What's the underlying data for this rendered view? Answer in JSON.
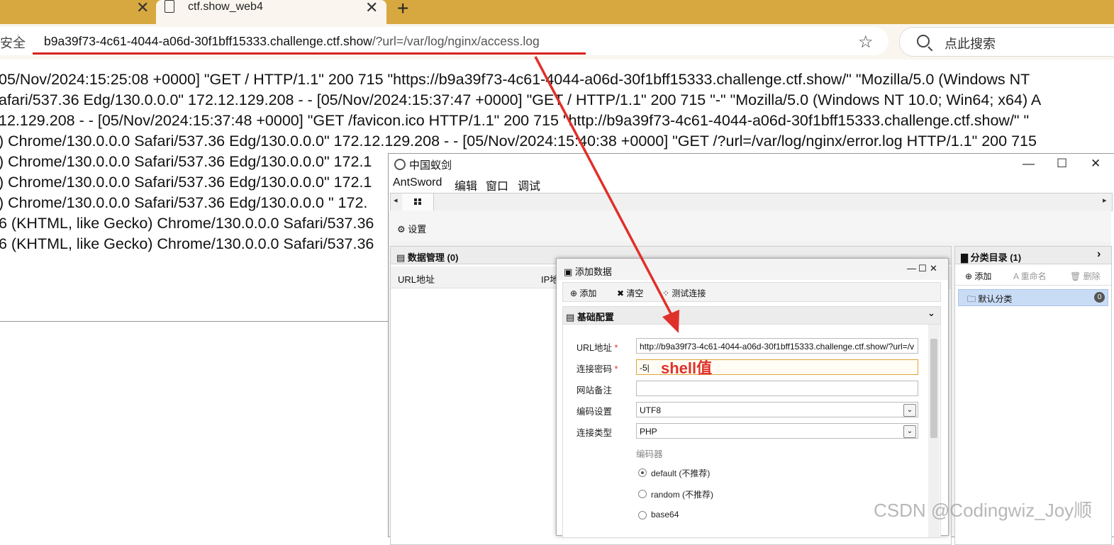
{
  "browser": {
    "tabs": [
      {
        "title": ""
      },
      {
        "title": "ctf.show_web4"
      }
    ],
    "close_glyph": "✕",
    "new_tab_glyph": "+",
    "address": {
      "security": "安全",
      "host": "b9a39f73-4c61-4044-a06d-30f1bff15333.challenge.ctf.show",
      "path": "/?url=/var/log/nginx/access.log"
    },
    "star_glyph": "☆",
    "search_placeholder": "点此搜索"
  },
  "log_lines": [
    "05/Nov/2024:15:25:08 +0000] \"GET / HTTP/1.1\" 200 715 \"https://b9a39f73-4c61-4044-a06d-30f1bff15333.challenge.ctf.show/\" \"Mozilla/5.0 (Windows NT",
    "afari/537.36 Edg/130.0.0.0\" 172.12.129.208 - - [05/Nov/2024:15:37:47 +0000] \"GET / HTTP/1.1\" 200 715 \"-\" \"Mozilla/5.0 (Windows NT 10.0; Win64; x64) A",
    "12.129.208 - - [05/Nov/2024:15:37:48 +0000] \"GET /favicon.ico HTTP/1.1\" 200 715 \"http://b9a39f73-4c61-4044-a06d-30f1bff15333.challenge.ctf.show/\" \"",
    ") Chrome/130.0.0.0 Safari/537.36 Edg/130.0.0.0\" 172.12.129.208 - - [05/Nov/2024:15:40:38 +0000] \"GET /?url=/var/log/nginx/error.log HTTP/1.1\" 200 715",
    ") Chrome/130.0.0.0 Safari/537.36 Edg/130.0.0.0\" 172.1",
    ") Chrome/130.0.0.0 Safari/537.36 Edg/130.0.0.0\" 172.1",
    ") Chrome/130.0.0.0 Safari/537.36 Edg/130.0.0.0 \" 172.",
    "6 (KHTML, like Gecko) Chrome/130.0.0.0 Safari/537.36",
    "6 (KHTML, like Gecko) Chrome/130.0.0.0 Safari/537.36"
  ],
  "antsword": {
    "title": "中国蚁剑",
    "window_buttons": {
      "minimize": "—",
      "maximize": "☐",
      "close": "✕"
    },
    "menu": [
      "AntSword",
      "编辑",
      "窗口",
      "调试"
    ],
    "settings_label": "⚙ 设置",
    "data_panel": {
      "title": "▤ 数据管理 (0)",
      "columns": [
        "URL地址",
        "IP地"
      ]
    },
    "category_panel": {
      "title": "▇ 分类目录 (1)",
      "chevron": "›",
      "add": "⊕ 添加",
      "rename": "A 重命名",
      "delete": "🗑 删除",
      "default_item": "🗀 默认分类",
      "count": "0"
    },
    "dialog": {
      "title": "▣ 添加数据",
      "buttons": {
        "minimize": "—",
        "maximize": "☐",
        "close": "✕"
      },
      "toolbar": {
        "add": "⊕ 添加",
        "clear": "✖ 清空",
        "test": "⁘ 测试连接"
      },
      "section": "▤ 基础配置",
      "section_chevron": "⌄",
      "fields": {
        "url_label": "URL地址",
        "url_value": "http://b9a39f73-4c61-4044-a06d-30f1bff15333.challenge.ctf.show/?url=/v",
        "password_label": "连接密码",
        "password_value": "-5|",
        "note_label": "网站备注",
        "note_value": "",
        "encoding_label": "编码设置",
        "encoding_value": "UTF8",
        "type_label": "连接类型",
        "type_value": "PHP",
        "encoder_label": "编码器",
        "required_mark": "*",
        "select_chevron": "⌄"
      },
      "encoders": [
        {
          "label": "default (不推荐)",
          "selected": true
        },
        {
          "label": "random (不推荐)",
          "selected": false
        },
        {
          "label": "base64",
          "selected": false
        }
      ]
    }
  },
  "annotation": {
    "text": "shell值",
    "color": "#e0302a"
  },
  "watermark": "CSDN @Codingwiz_Joy顺"
}
